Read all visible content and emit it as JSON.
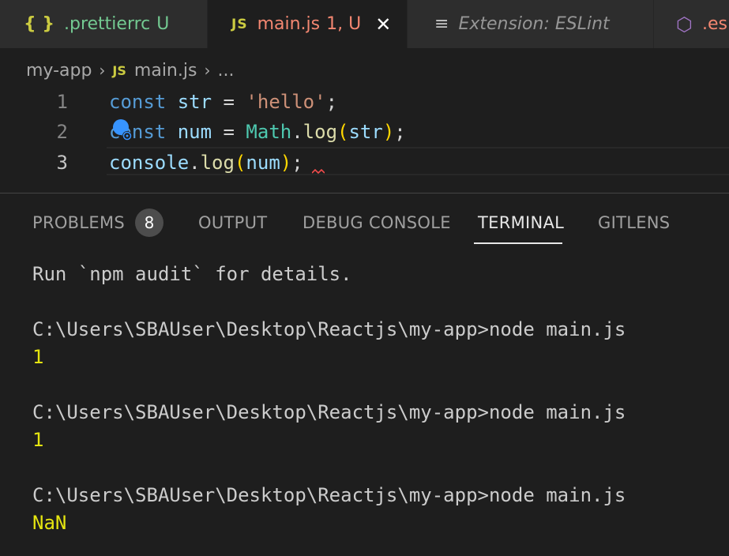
{
  "tabs": [
    {
      "icon": "{ }",
      "name": ".prettierrc",
      "status": "U"
    },
    {
      "icon": "JS",
      "name": "main.js",
      "status": "1, U",
      "close": "✕"
    },
    {
      "icon": "≡",
      "name": "Extension: ESLint"
    },
    {
      "icon": "⬡",
      "name": ".es"
    }
  ],
  "breadcrumb": {
    "folder": "my-app",
    "file_icon": "JS",
    "file": "main.js",
    "more": "..."
  },
  "editor": {
    "line_numbers": [
      "1",
      "2",
      "3"
    ],
    "lines": [
      [
        [
          "kw",
          "const"
        ],
        [
          "punc",
          " "
        ],
        [
          "var",
          "str"
        ],
        [
          "punc",
          " = "
        ],
        [
          "str",
          "'hello'"
        ],
        [
          "punc",
          ";"
        ]
      ],
      [
        [
          "kw",
          "const"
        ],
        [
          "punc",
          " "
        ],
        [
          "var",
          "num"
        ],
        [
          "punc",
          " = "
        ],
        [
          "obj",
          "Math"
        ],
        [
          "punc",
          "."
        ],
        [
          "fn",
          "log"
        ],
        [
          "paren",
          "("
        ],
        [
          "var",
          "str"
        ],
        [
          "paren",
          ")"
        ],
        [
          "punc",
          ";"
        ]
      ],
      [
        [
          "var",
          "console"
        ],
        [
          "punc",
          "."
        ],
        [
          "fn",
          "log"
        ],
        [
          "paren",
          "("
        ],
        [
          "var",
          "num"
        ],
        [
          "paren",
          ")"
        ],
        [
          "punc",
          ";"
        ]
      ]
    ]
  },
  "panel": {
    "tabs": [
      "PROBLEMS",
      "OUTPUT",
      "DEBUG CONSOLE",
      "TERMINAL",
      "GITLENS"
    ],
    "problems_count": "8",
    "active_tab": "TERMINAL"
  },
  "terminal": [
    {
      "text": "Run `npm audit` for details.",
      "style": "normal"
    },
    {
      "text": "",
      "style": "normal"
    },
    {
      "text": "C:\\Users\\SBAUser\\Desktop\\Reactjs\\my-app>node main.js",
      "style": "normal"
    },
    {
      "text": "1",
      "style": "yellow"
    },
    {
      "text": "",
      "style": "normal"
    },
    {
      "text": "C:\\Users\\SBAUser\\Desktop\\Reactjs\\my-app>node main.js",
      "style": "normal"
    },
    {
      "text": "1",
      "style": "yellow"
    },
    {
      "text": "",
      "style": "normal"
    },
    {
      "text": "C:\\Users\\SBAUser\\Desktop\\Reactjs\\my-app>node main.js",
      "style": "normal"
    },
    {
      "text": "NaN",
      "style": "yellow"
    }
  ],
  "colors": {
    "accent_yellow": "#e5e510",
    "modified_red": "#f48771",
    "untracked_green": "#73c991",
    "badge_bg": "#4d4d4d"
  }
}
